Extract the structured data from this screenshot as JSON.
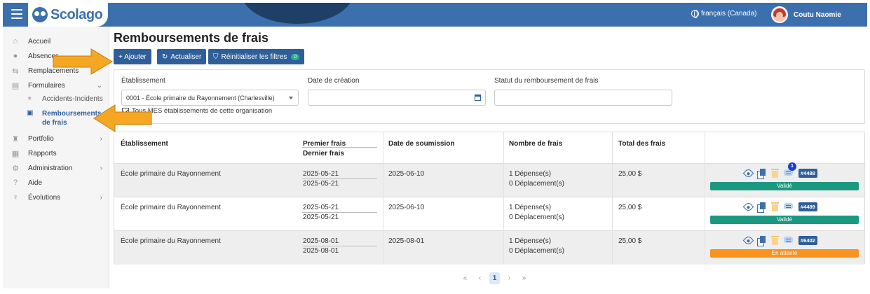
{
  "header": {
    "app_name": "Scolago",
    "language": "français (Canada)",
    "user_name": "Coutu Naomie",
    "brand_color": "#3c6fad"
  },
  "sidebar": {
    "items": [
      {
        "label": "Accueil",
        "icon": "home-icon"
      },
      {
        "label": "Absences",
        "icon": "user-clock-icon"
      },
      {
        "label": "Remplacements",
        "icon": "swap-icon"
      },
      {
        "label": "Formulaires",
        "icon": "form-icon",
        "chevron": "⌄"
      },
      {
        "label": "Portfolio",
        "icon": "trophy-icon",
        "chevron": "›"
      },
      {
        "label": "Rapports",
        "icon": "report-icon"
      },
      {
        "label": "Administration",
        "icon": "gear-icon",
        "chevron": "›"
      },
      {
        "label": "Aide",
        "icon": "help-icon"
      },
      {
        "label": "Évolutions",
        "icon": "evolution-icon",
        "chevron": "›"
      }
    ],
    "sub_items": [
      {
        "label": "Accidents-Incidents",
        "icon": "accident-icon"
      },
      {
        "label_line1": "Remboursements",
        "label_line2": "de frais",
        "icon": "receipt-icon",
        "active": true
      }
    ]
  },
  "main": {
    "title": "Remboursements de frais",
    "buttons": {
      "add": "+ Ajouter",
      "refresh": "Actualiser",
      "reset_filters": "Réinitialiser les filtres",
      "reset_count": "0"
    }
  },
  "filters": {
    "establishment_label": "Établissement",
    "establishment_value": "0001 - École primaire du Rayonnement (Charlesville)",
    "creation_date_label": "Date de création",
    "creation_date_value": "",
    "status_label": "Statut du remboursement de frais",
    "status_value": "",
    "checkbox_label": "Tous MES établissements de cette organisation",
    "checkbox_checked": true
  },
  "table": {
    "headers": {
      "establishment": "Établissement",
      "first_fee": "Premier frais",
      "last_fee": "Dernier frais",
      "submission_date": "Date de soumission",
      "fee_count": "Nombre de frais",
      "total": "Total des frais"
    },
    "rows": [
      {
        "establishment": "École primaire du Rayonnement",
        "first": "2025-05-21",
        "last": "2025-05-21",
        "submitted": "2025-06-10",
        "expenses": "1 Dépense(s)",
        "trips": "0 Déplacement(s)",
        "total": "25,00 $",
        "id": "#4488",
        "status": "Validé",
        "status_color": "#1a9980",
        "notifications": "1"
      },
      {
        "establishment": "École primaire du Rayonnement",
        "first": "2025-05-21",
        "last": "2025-05-21",
        "submitted": "2025-06-10",
        "expenses": "1 Dépense(s)",
        "trips": "0 Déplacement(s)",
        "total": "25,00 $",
        "id": "#4489",
        "status": "Validé",
        "status_color": "#1a9980",
        "notifications": ""
      },
      {
        "establishment": "École primaire du Rayonnement",
        "first": "2025-08-01",
        "last": "2025-08-01",
        "submitted": "2025-08-01",
        "expenses": "1 Dépense(s)",
        "trips": "0 Déplacement(s)",
        "total": "25,00 $",
        "id": "#6402",
        "status": "En attente",
        "status_color": "#f7931e",
        "notifications": ""
      }
    ]
  },
  "pagination": {
    "first": "«",
    "prev": "‹",
    "current": "1",
    "next": "›",
    "last": "»"
  },
  "annotations": {
    "arrow_color": "#f5a623"
  }
}
